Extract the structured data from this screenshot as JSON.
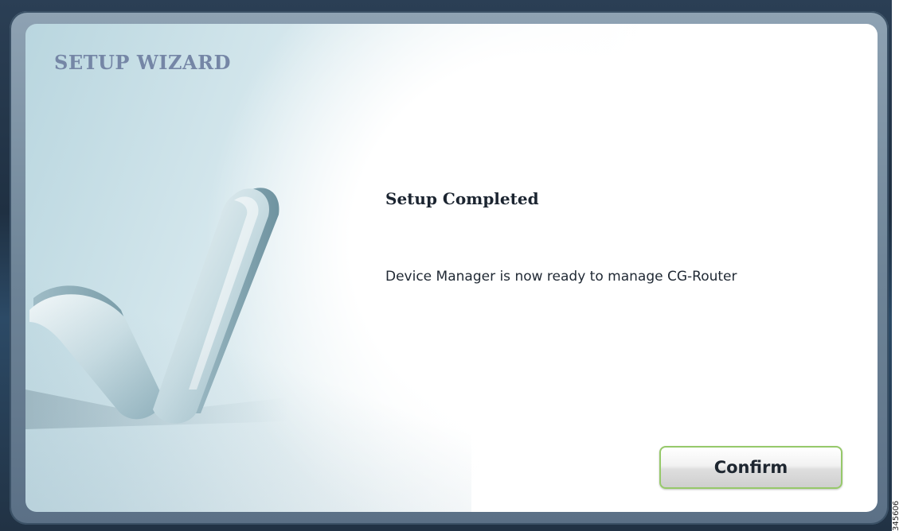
{
  "wizard": {
    "title": "SETUP WIZARD",
    "heading": "Setup Completed",
    "message": "Device Manager is now ready to manage CG-Router",
    "confirm_label": "Confirm"
  },
  "figure_id": "345606",
  "icons": {
    "checkmark": "checkmark-icon"
  },
  "colors": {
    "title": "#7586a6",
    "confirm_border": "#96c96a",
    "frame": "#6f8598"
  }
}
